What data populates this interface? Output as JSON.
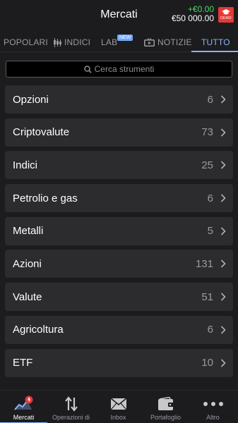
{
  "header": {
    "title": "Mercati",
    "profit_loss": "+€0.00",
    "balance": "€50 000.00",
    "demo_label": "DEMO"
  },
  "tabs": [
    {
      "label": "POPOLARI",
      "active": false
    },
    {
      "label": "INDICI",
      "active": false,
      "icon": "candlestick-icon"
    },
    {
      "label": "LAB",
      "active": false,
      "badge": "NEW"
    },
    {
      "label": "NOTIZIE",
      "active": false,
      "icon": "tv-icon"
    },
    {
      "label": "TUTTO",
      "active": true
    }
  ],
  "search": {
    "placeholder": "Cerca strumenti",
    "icon": "search-icon"
  },
  "categories": [
    {
      "name": "Opzioni",
      "count": "6"
    },
    {
      "name": "Criptovalute",
      "count": "73"
    },
    {
      "name": "Indici",
      "count": "25"
    },
    {
      "name": "Petrolio e gas",
      "count": "6"
    },
    {
      "name": "Metalli",
      "count": "5"
    },
    {
      "name": "Azioni",
      "count": "131"
    },
    {
      "name": "Valute",
      "count": "51"
    },
    {
      "name": "Agricoltura",
      "count": "6"
    },
    {
      "name": "ETF",
      "count": "10"
    }
  ],
  "bottom_nav": [
    {
      "label": "Mercati",
      "icon": "markets-chart-icon",
      "active": true
    },
    {
      "label": "Operazioni di",
      "icon": "trade-arrows-icon",
      "active": false
    },
    {
      "label": "Inbox",
      "icon": "envelope-icon",
      "active": false
    },
    {
      "label": "Portafoglio",
      "icon": "wallet-icon",
      "active": false
    },
    {
      "label": "Altro",
      "icon": "more-dots-icon",
      "active": false
    }
  ],
  "colors": {
    "background": "#1c1c1e",
    "row_background": "#2c2c2e",
    "accent": "#8ab4f8",
    "profit": "#4cd964",
    "demo": "#e53935"
  }
}
